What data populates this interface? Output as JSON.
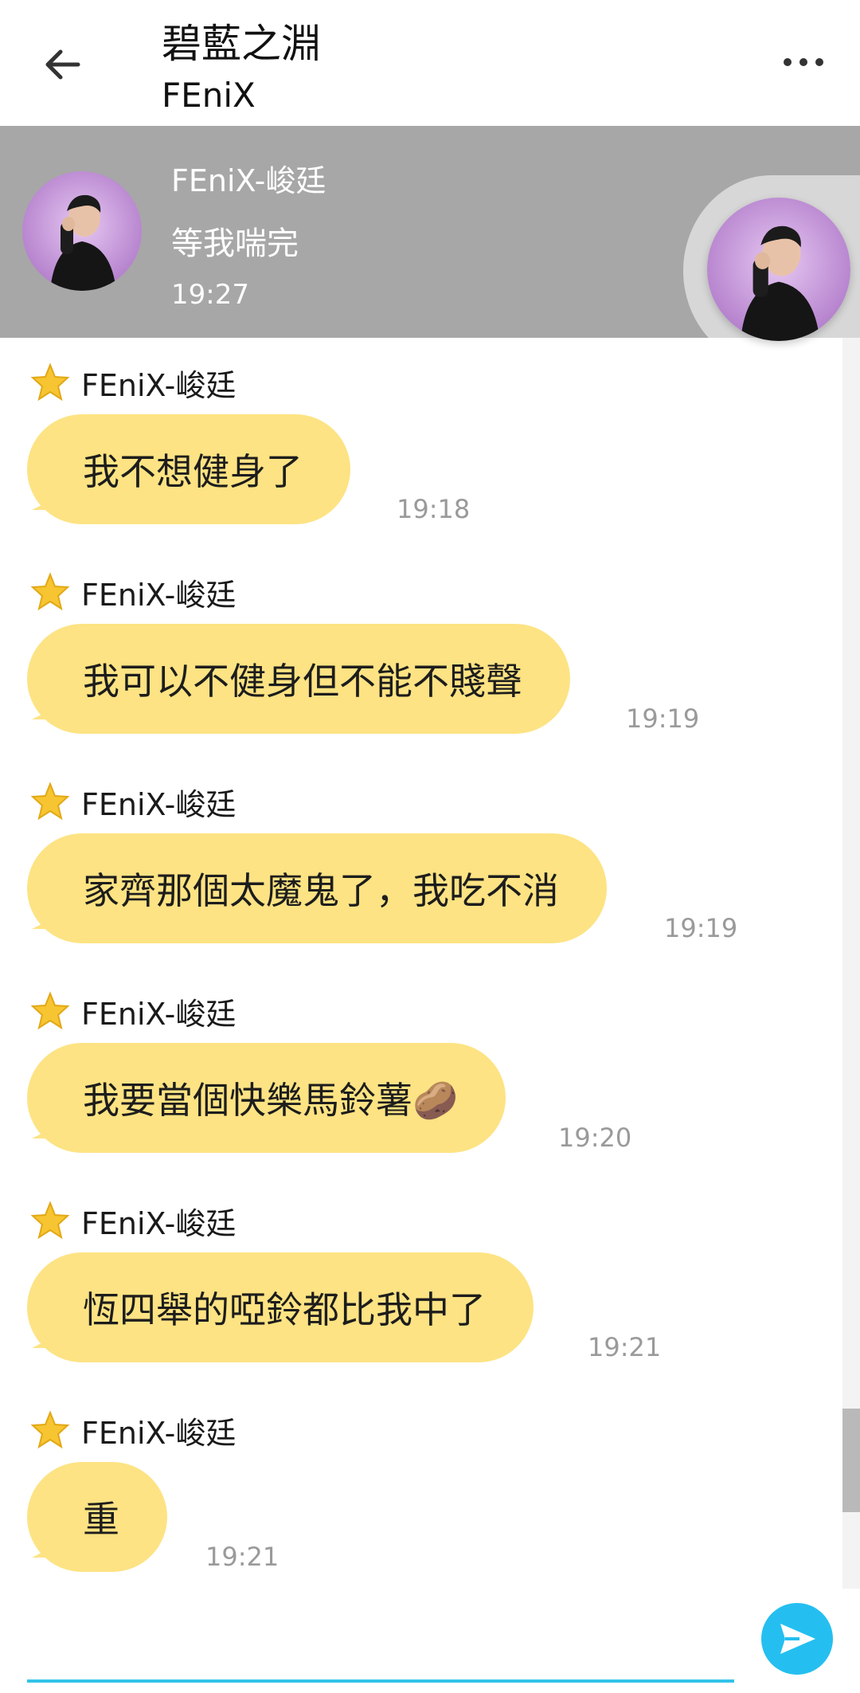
{
  "header": {
    "title": "碧藍之淵",
    "subtitle": "FEniX",
    "back_icon": "arrow-left-icon",
    "more_icon": "more-horizontal-icon"
  },
  "pinned": {
    "sender": "FEniX-峻廷",
    "message": "等我喘完",
    "time": "19:27"
  },
  "messages": [
    {
      "sender": "FEniX-峻廷",
      "text": "我不想健身了",
      "time": "19:18"
    },
    {
      "sender": "FEniX-峻廷",
      "text": "我可以不健身但不能不賤聲",
      "time": "19:19"
    },
    {
      "sender": "FEniX-峻廷",
      "text": "家齊那個太魔鬼了，我吃不消",
      "time": "19:19"
    },
    {
      "sender": "FEniX-峻廷",
      "text": "我要當個快樂馬鈴薯🥔",
      "time": "19:20"
    },
    {
      "sender": "FEniX-峻廷",
      "text": "恆四舉的啞鈴都比我中了",
      "time": "19:21"
    },
    {
      "sender": "FEniX-峻廷",
      "text": "重",
      "time": "19:21"
    }
  ],
  "composer": {
    "send_icon": "send-icon"
  },
  "colors": {
    "bubble": "#fde383",
    "accent": "#24bff0",
    "pinned_bg": "#a7a7a7"
  }
}
